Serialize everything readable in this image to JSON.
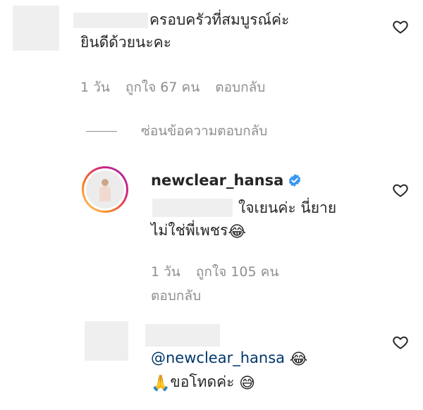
{
  "comment1": {
    "text_line1": "ครอบครัวที่สมบูรณ์ค่ะ",
    "text_line2": "ยินดีด้วยนะคะ",
    "time": "1 วัน",
    "likes": "ถูกใจ 67 คน",
    "reply": "ตอบกลับ"
  },
  "hide_replies": "ซ่อนข้อความตอบกลับ",
  "reply1": {
    "username": "newclear_hansa",
    "text_line1": "ใจเยนค่ะ นี่ยาย",
    "text_line2": "ไม่ใช่พี่เพชร",
    "emoji": "😂",
    "time": "1 วัน",
    "likes": "ถูกใจ 105 คน",
    "reply": "ตอบกลับ"
  },
  "reply2": {
    "mention": "@newclear_hansa",
    "emoji1": "😂",
    "prayer": "🙏",
    "text": "ขอโทดค่ะ",
    "emoji2": "😅"
  },
  "icons": {
    "like": "heart-outline-icon",
    "verified": "verified-badge-icon"
  },
  "colors": {
    "text": "#262626",
    "secondary": "#8e8e8e",
    "verified": "#3897f0",
    "mention": "#00376b"
  }
}
